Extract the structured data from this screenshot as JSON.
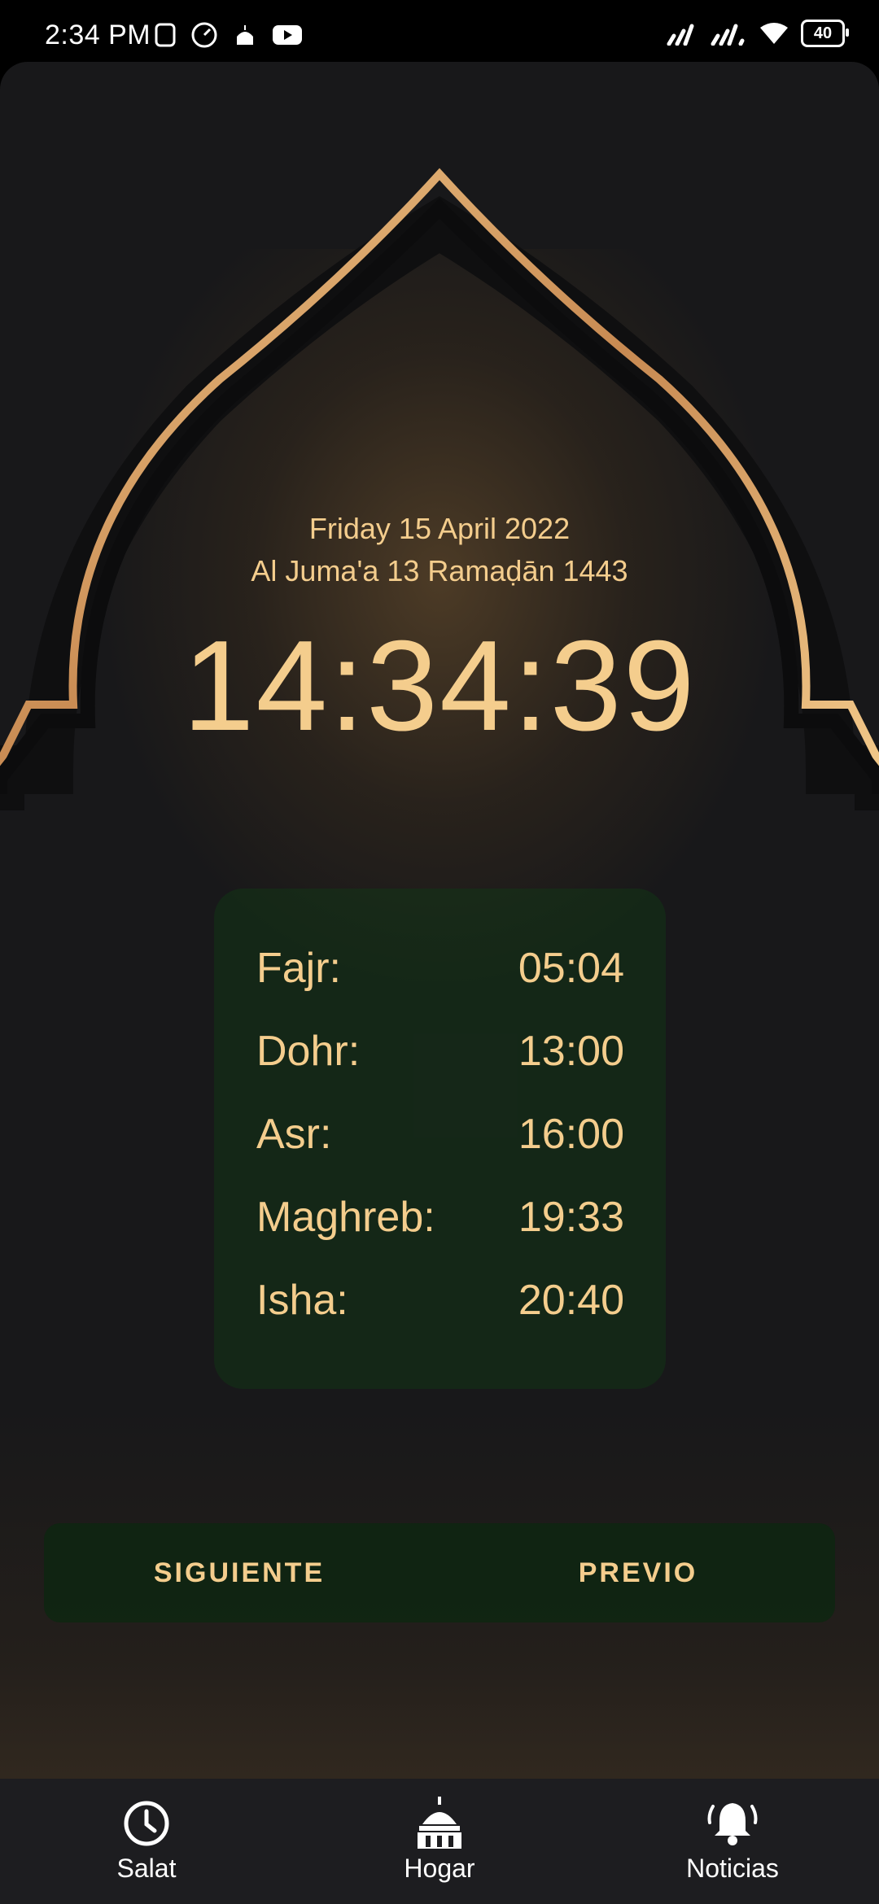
{
  "status_bar": {
    "time": "2:34 PM",
    "battery": "40"
  },
  "main": {
    "gregorian_date": "Friday 15 April 2022",
    "hijri_date": "Al Juma'a 13 Ramaḍān 1443",
    "clock": "14:34:39"
  },
  "prayer_times": [
    {
      "name": "Fajr:",
      "time": "05:04"
    },
    {
      "name": "Dohr:",
      "time": "13:00"
    },
    {
      "name": "Asr:",
      "time": "16:00"
    },
    {
      "name": "Maghreb:",
      "time": "19:33"
    },
    {
      "name": "Isha:",
      "time": "20:40"
    }
  ],
  "buttons": {
    "next_label": "SIGUIENTE",
    "prev_label": "PREVIO"
  },
  "bottom_nav": {
    "items": [
      {
        "label": "Salat",
        "icon": "clock-icon"
      },
      {
        "label": "Hogar",
        "icon": "mosque-icon"
      },
      {
        "label": "Noticias",
        "icon": "bell-icon"
      }
    ]
  },
  "colors": {
    "accent_gold": "#f4cd8d",
    "background": "#18181a",
    "card_green": "#123416"
  }
}
